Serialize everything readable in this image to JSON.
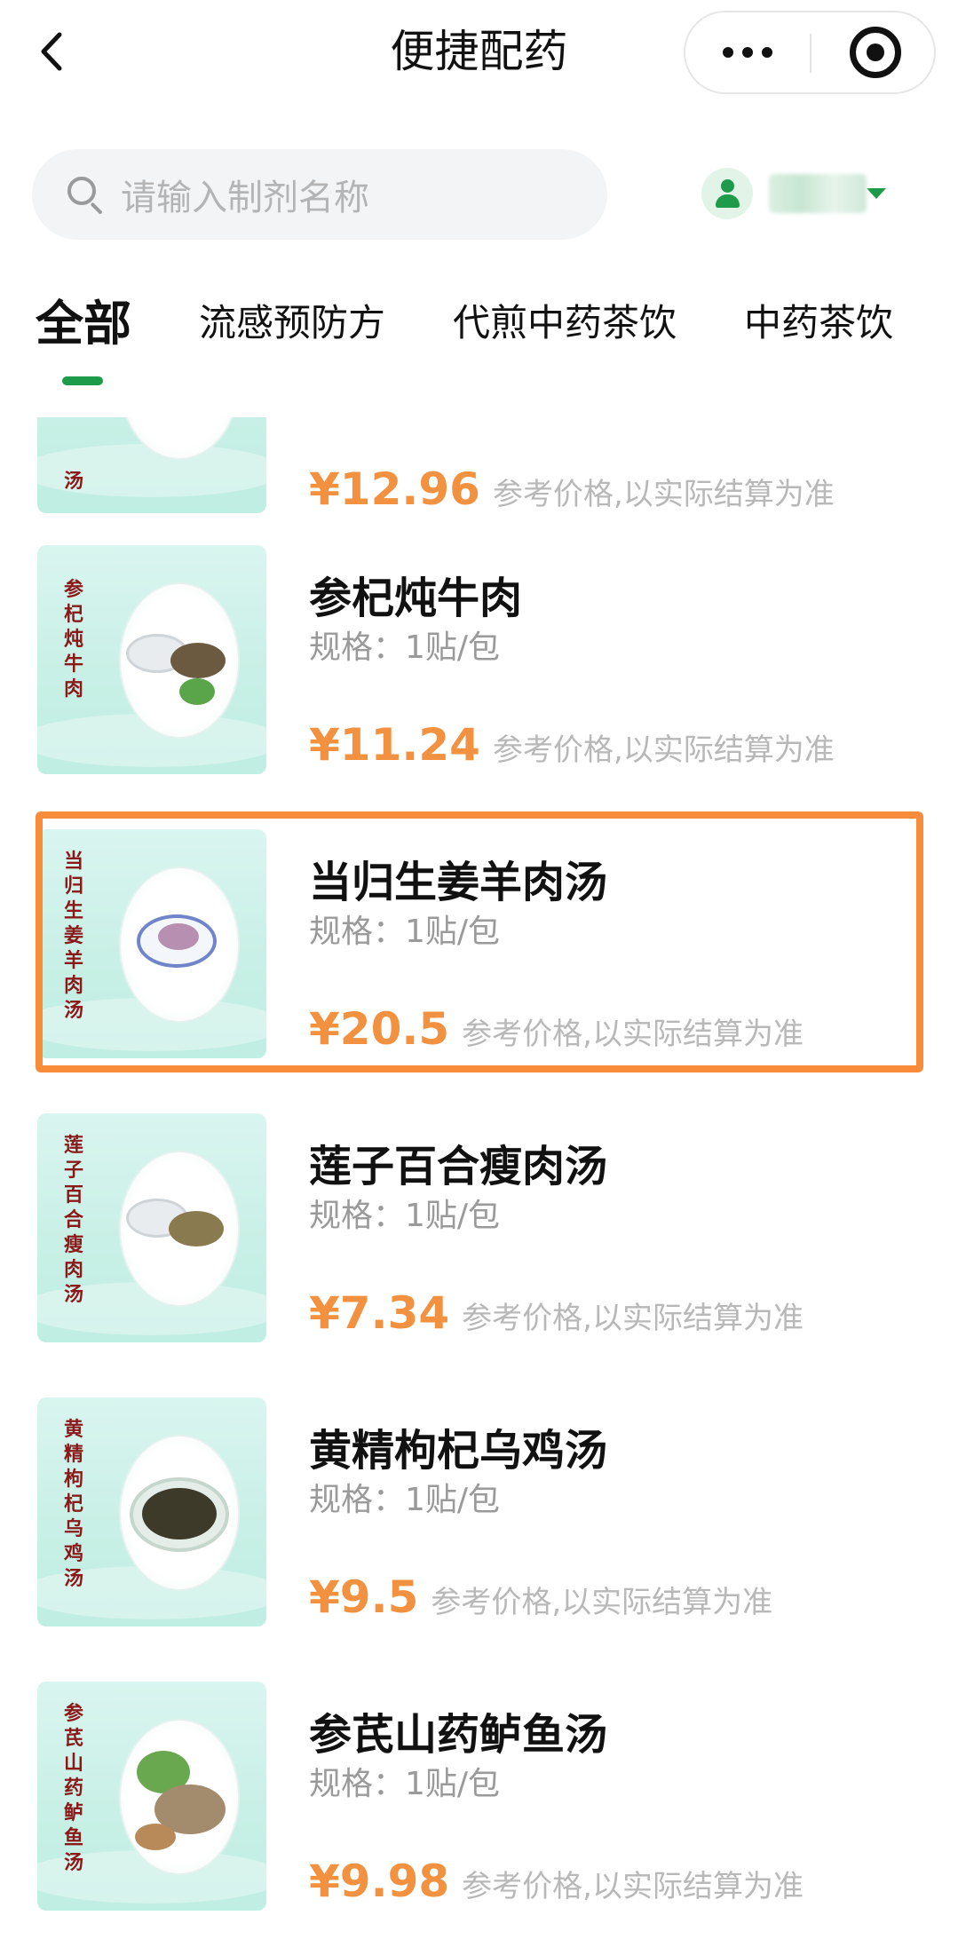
{
  "header": {
    "title": "便捷配药",
    "back_icon": "chevron-left-icon",
    "more_icon": "more-dots-icon",
    "target_icon": "target-circle-icon"
  },
  "search": {
    "placeholder": "请输入制剂名称",
    "icon": "search-icon"
  },
  "user": {
    "avatar_icon": "user-icon",
    "dropdown_icon": "caret-down-icon",
    "accent_color": "#1e9b4a"
  },
  "tabs": [
    {
      "label": "全部",
      "active": true
    },
    {
      "label": "流感预防方",
      "active": false
    },
    {
      "label": "代煎中药茶饮",
      "active": false
    },
    {
      "label": "中药茶饮",
      "active": false
    }
  ],
  "price_note": "参考价格,以实际结算为准",
  "spec_label": "规格：1贴/包",
  "products": [
    {
      "name": "",
      "thumb_text": "汤",
      "price": "¥12.96"
    },
    {
      "name": "参杞炖牛肉",
      "thumb_text": "参杞炖牛肉",
      "price": "¥11.24"
    },
    {
      "name": "当归生姜羊肉汤",
      "thumb_text": "当归生姜羊肉汤",
      "price": "¥20.5",
      "highlighted": true
    },
    {
      "name": "莲子百合瘦肉汤",
      "thumb_text": "莲子百合瘦肉汤",
      "price": "¥7.34"
    },
    {
      "name": "黄精枸杞乌鸡汤",
      "thumb_text": "黄精枸杞乌鸡汤",
      "price": "¥9.5"
    },
    {
      "name": "参芪山药鲈鱼汤",
      "thumb_text": "参芪山药鲈鱼汤",
      "price": "¥9.98"
    }
  ],
  "colors": {
    "price": "#f2913f",
    "highlight_border": "#f98c3b",
    "thumb_bg": "#c9f0e6",
    "thumb_text": "#8a1a1a"
  }
}
